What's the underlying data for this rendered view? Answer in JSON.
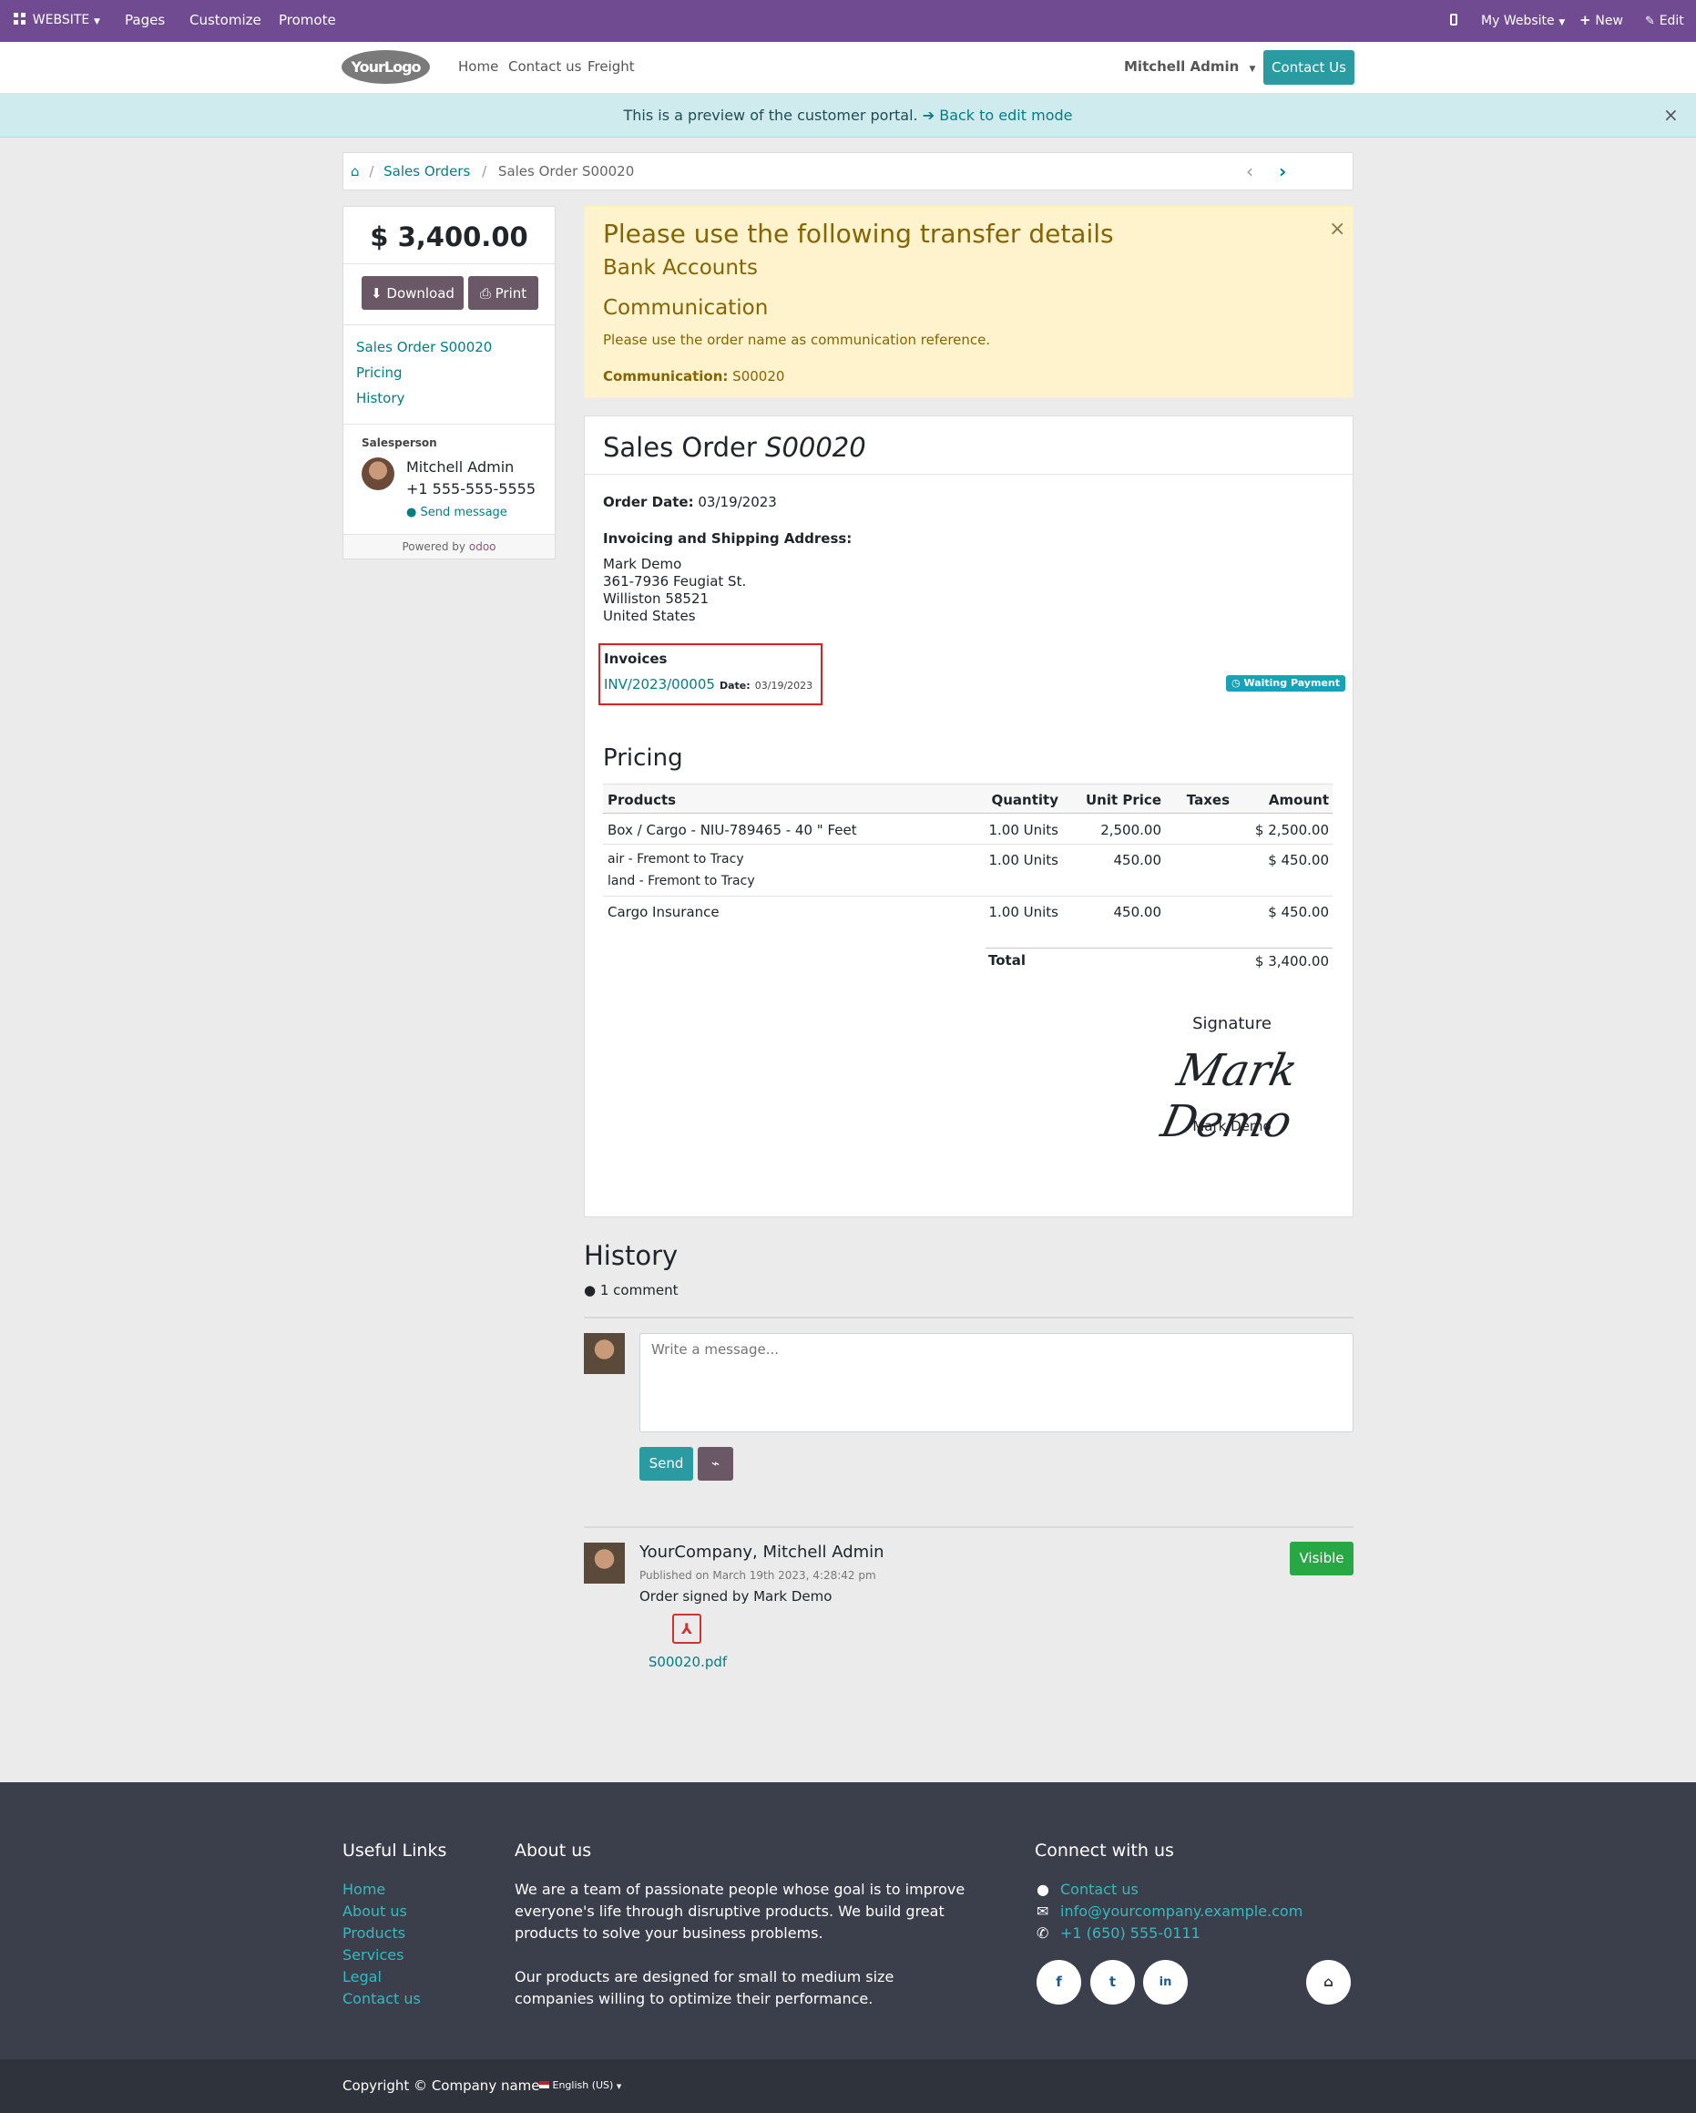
{
  "topbar": {
    "website_label": "WEBSITE",
    "pages_label": "Pages",
    "customize_label": "Customize",
    "promote_label": "Promote",
    "my_website_label": "My Website",
    "new_label": "New",
    "edit_label": "Edit"
  },
  "navbar": {
    "logo_text": "YourLogo",
    "items": [
      "Home",
      "Contact us",
      "Freight"
    ],
    "user_label": "Mitchell Admin",
    "contact_button": "Contact Us"
  },
  "preview_banner": {
    "text": "This is a preview of the customer portal.",
    "back_link": "Back to edit mode"
  },
  "breadcrumb": {
    "sales_orders": "Sales Orders",
    "current": "Sales Order S00020"
  },
  "sidebar": {
    "amount": "$ 3,400.00",
    "download_label": "Download",
    "print_label": "Print",
    "nav": [
      "Sales Order S00020",
      "Pricing",
      "History"
    ],
    "salesperson_heading": "Salesperson",
    "salesperson_name": "Mitchell Admin",
    "salesperson_phone": "+1 555-555-5555",
    "send_message": "Send message",
    "powered_by": "Powered by",
    "powered_brand": "odoo"
  },
  "transfer_alert": {
    "title": "Please use the following transfer details",
    "bank_accounts": "Bank Accounts",
    "communication_heading": "Communication",
    "note": "Please use the order name as communication reference.",
    "communication_label": "Communication:",
    "communication_value": "S00020"
  },
  "order": {
    "title_prefix": "Sales Order",
    "title_ref": "S00020",
    "order_date_label": "Order Date:",
    "order_date": "03/19/2023",
    "address_heading": "Invoicing and Shipping Address:",
    "address_lines": [
      "Mark Demo",
      "361-7936 Feugiat St.",
      "Williston 58521",
      "United States"
    ],
    "invoices_heading": "Invoices",
    "invoice_number": "INV/2023/00005",
    "invoice_date_label": "Date:",
    "invoice_date": "03/19/2023",
    "invoice_status": "Waiting Payment"
  },
  "pricing": {
    "heading": "Pricing",
    "columns": [
      "Products",
      "Quantity",
      "Unit Price",
      "Taxes",
      "Amount"
    ],
    "rows": [
      {
        "product": "Box / Cargo - NIU-789465 - 40 \" Feet",
        "product2": "",
        "quantity": "1.00 Units",
        "unit_price": "2,500.00",
        "taxes": "",
        "amount": "$ 2,500.00"
      },
      {
        "product": "air - Fremont to Tracy",
        "product2": "land - Fremont to Tracy",
        "quantity": "1.00 Units",
        "unit_price": "450.00",
        "taxes": "",
        "amount": "$ 450.00"
      },
      {
        "product": "Cargo Insurance",
        "product2": "",
        "quantity": "1.00 Units",
        "unit_price": "450.00",
        "taxes": "",
        "amount": "$ 450.00"
      }
    ],
    "total_label": "Total",
    "total_value": "$ 3,400.00"
  },
  "signature": {
    "heading": "Signature",
    "signed_name": "Mark Demo",
    "name": "Mark Demo"
  },
  "history": {
    "heading": "History",
    "comments": "1 comment",
    "message_placeholder": "Write a message...",
    "send_label": "Send",
    "message_author": "YourCompany, Mitchell Admin",
    "message_date": "Published on March 19th 2023, 4:28:42 pm",
    "message_body": "Order signed by Mark Demo",
    "attachment_name": "S00020.pdf",
    "visible_label": "Visible"
  },
  "footer": {
    "useful_links_heading": "Useful Links",
    "useful_links": [
      "Home",
      "About us",
      "Products",
      "Services",
      "Legal",
      "Contact us"
    ],
    "about_heading": "About us",
    "about_lines1": [
      "We are a team of passionate people whose goal is to improve",
      "everyone's life through disruptive products. We build great",
      "products to solve your business problems."
    ],
    "about_lines2": [
      "Our products are designed for small to medium size",
      "companies willing to optimize their performance."
    ],
    "connect_heading": "Connect with us",
    "contact_link": "Contact us",
    "email": "info@yourcompany.example.com",
    "phone": "+1 (650) 555-0111",
    "copyright": "Copyright © Company name",
    "language": "English (US)"
  },
  "colors": {
    "topbar": "#714b91",
    "accent": "#017e84",
    "teal_button": "#2a9ba0",
    "alert_bg": "#fff3cd",
    "alert_text": "#856404",
    "success": "#28a745",
    "footer_bg": "#3a3f4b"
  }
}
